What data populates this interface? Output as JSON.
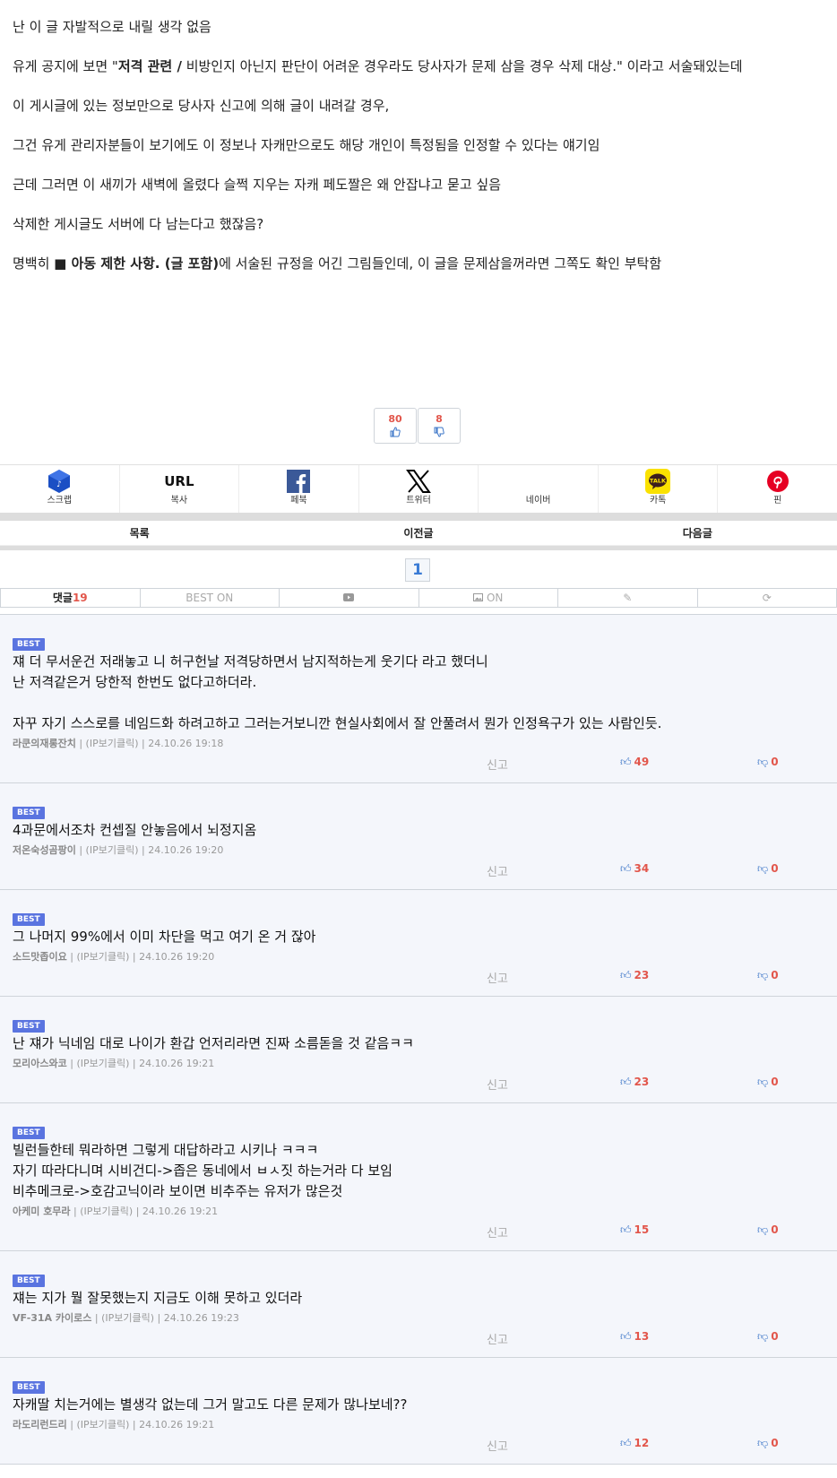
{
  "article": {
    "lines": [
      {
        "t": "난 이 글 자발적으로 내릴 생각 없음"
      },
      {
        "pre": "유게 공지에 보면 \"",
        "b": "저격 관련 /",
        "post": " 비방인지 아닌지 판단이 어려운 경우라도 당사자가 문제 삼을 경우 삭제 대상.\" 이라고 서술돼있는데"
      },
      {
        "t": "이 게시글에 있는 정보만으로 당사자 신고에 의해 글이 내려갈 경우,"
      },
      {
        "t": "그건 유게 관리자분들이 보기에도 이 정보나 자캐만으로도 해당 개인이 특정됨을 인정할 수 있다는 얘기임"
      },
      {
        "t": "근데 그러면 이 새끼가 새벽에 올렸다 슬쩍 지우는 자캐 페도짤은 왜 안잡냐고 묻고 싶음"
      },
      {
        "t": "삭제한 게시글도 서버에 다 남는다고 했잖음?"
      },
      {
        "pre": "명백히 ",
        "b": "■ 아동 제한 사항. (글 포함)",
        "post": "에 서술된 규정을 어긴 그림들인데, 이 글을 문제삼을꺼라면 그쪽도 확인 부탁함"
      }
    ]
  },
  "votes": {
    "up": "80",
    "down": "8"
  },
  "share": [
    {
      "label": "스크랩",
      "icon": "scrap-icon"
    },
    {
      "label": "복사",
      "icon": "url-icon",
      "logo_text": "URL"
    },
    {
      "label": "페북",
      "icon": "facebook-icon"
    },
    {
      "label": "트위터",
      "icon": "x-icon"
    },
    {
      "label": "네이버",
      "icon": "naver-icon"
    },
    {
      "label": "카톡",
      "icon": "kakaotalk-icon",
      "logo_text": "TALK"
    },
    {
      "label": "핀",
      "icon": "pinterest-icon"
    }
  ],
  "nav": {
    "list": "목록",
    "prev": "이전글",
    "next": "다음글"
  },
  "pager": {
    "current": "1"
  },
  "tabs": {
    "comments_label": "댓글",
    "comments_count": "19",
    "best": "BEST ON",
    "image": "ON"
  },
  "colors": {
    "accent": "#3a7bd5",
    "best_badge": "#5a74e0",
    "count_red": "#e2564b",
    "comment_bg": "#f4f6fb"
  },
  "comments": [
    {
      "badge": "BEST",
      "text": "쟤 더 무서운건 저래놓고 니 허구헌날 저격당하면서 남지적하는게 웃기다 라고 했더니\n난 저격같은거 당한적 한번도 없다고하더라.\n\n자꾸 자기 스스로를 네임드화 하려고하고 그러는거보니깐 현실사회에서 잘 안풀려서 뭔가 인정욕구가 있는 사람인듯.",
      "nick": "라쿤의재롱잔치",
      "ip": "(IP보기클릭)",
      "date": "24.10.26 19:18",
      "report": "신고",
      "up": "49",
      "down": "0"
    },
    {
      "badge": "BEST",
      "text": "4과문에서조차 컨셉질 안놓음에서 뇌정지옴",
      "nick": "저온숙성곰팡이",
      "ip": "(IP보기클릭)",
      "date": "24.10.26 19:20",
      "report": "신고",
      "up": "34",
      "down": "0"
    },
    {
      "badge": "BEST",
      "text": "그 나머지 99%에서 이미 차단을 먹고 여기 온 거 잖아",
      "nick": "소드맛좁이요",
      "ip": "(IP보기클릭)",
      "date": "24.10.26 19:20",
      "report": "신고",
      "up": "23",
      "down": "0"
    },
    {
      "badge": "BEST",
      "text": "난 쟤가 닉네임 대로 나이가 환갑 언저리라면 진짜 소름돋을 것 같음ㅋㅋ",
      "nick": "모리아스와코",
      "ip": "(IP보기클릭)",
      "date": "24.10.26 19:21",
      "report": "신고",
      "up": "23",
      "down": "0"
    },
    {
      "badge": "BEST",
      "text": "빌런들한테 뭐라하면 그렇게 대답하라고 시키나 ㅋㅋㅋ\n자기 따라다니며 시비건디->좁은 동네에서 ㅂㅅ짓 하는거라 다 보임\n비추메크로->호감고닉이라 보이면 비추주는 유저가 많은것",
      "nick": "아케미 호무라",
      "ip": "(IP보기클릭)",
      "date": "24.10.26 19:21",
      "report": "신고",
      "up": "15",
      "down": "0"
    },
    {
      "badge": "BEST",
      "text": "쟤는 지가 뭘 잘못했는지 지금도 이해 못하고 있더라",
      "nick": "VF-31A 카이로스",
      "ip": "(IP보기클릭)",
      "date": "24.10.26 19:23",
      "report": "신고",
      "up": "13",
      "down": "0"
    },
    {
      "badge": "BEST",
      "text": "자캐딸 치는거에는 별생각 없는데 그거 말고도 다른 문제가 많나보네??",
      "nick": "라도리런드리",
      "ip": "(IP보기클릭)",
      "date": "24.10.26 19:21",
      "report": "신고",
      "up": "12",
      "down": "0"
    }
  ]
}
